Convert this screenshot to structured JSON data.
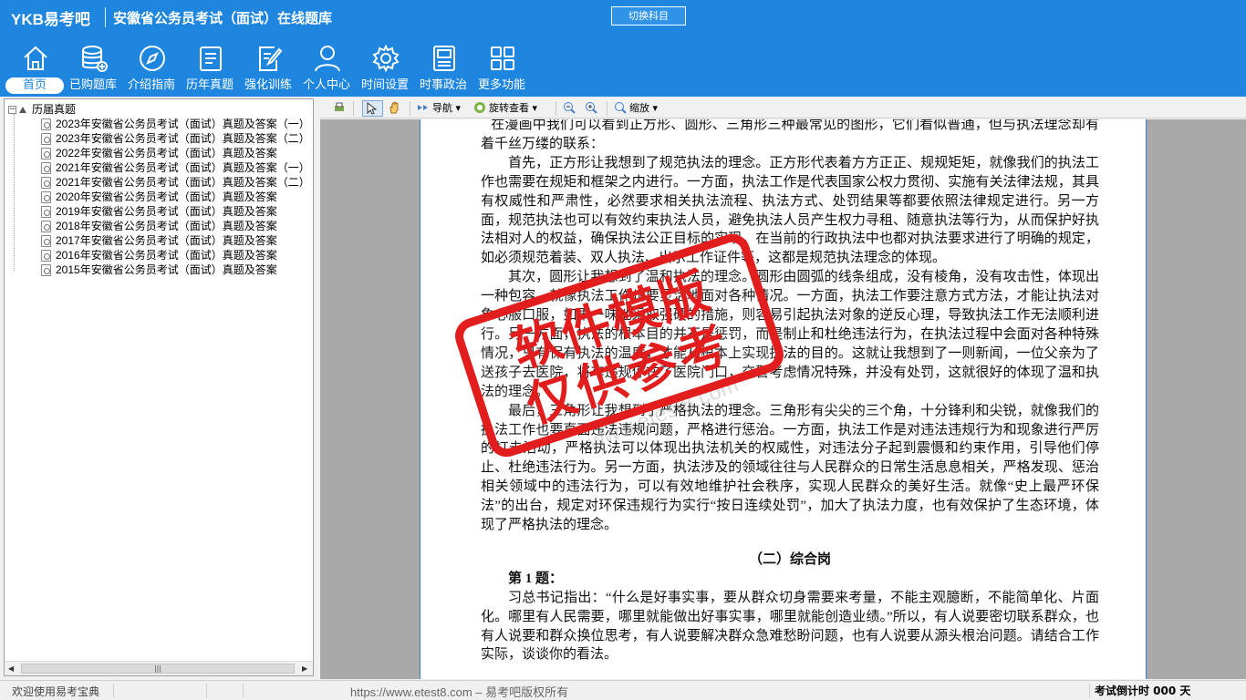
{
  "header": {
    "logo": "YKB易考吧",
    "app_title": "安徽省公务员考试（面试）在线题库",
    "switch_subject": "切换科目"
  },
  "nav": [
    {
      "label": "首页",
      "icon": "home-icon",
      "active": true
    },
    {
      "label": "已购题库",
      "icon": "database-icon"
    },
    {
      "label": "介绍指南",
      "icon": "compass-icon"
    },
    {
      "label": "历年真题",
      "icon": "list-icon"
    },
    {
      "label": "强化训练",
      "icon": "edit-icon"
    },
    {
      "label": "个人中心",
      "icon": "user-icon"
    },
    {
      "label": "时间设置",
      "icon": "gear-icon"
    },
    {
      "label": "时事政治",
      "icon": "news-icon"
    },
    {
      "label": "更多功能",
      "icon": "grid-icon"
    }
  ],
  "tree": {
    "root": "历届真题",
    "items": [
      "2023年安徽省公务员考试（面试）真题及答案（一）",
      "2023年安徽省公务员考试（面试）真题及答案（二）",
      "2022年安徽省公务员考试（面试）真题及答案",
      "2021年安徽省公务员考试（面试）真题及答案（一）",
      "2021年安徽省公务员考试（面试）真题及答案（二）",
      "2020年安徽省公务员考试（面试）真题及答案",
      "2019年安徽省公务员考试（面试）真题及答案",
      "2018年安徽省公务员考试（面试）真题及答案",
      "2017年安徽省公务员考试（面试）真题及答案",
      "2016年安徽省公务员考试（面试）真题及答案",
      "2015年安徽省公务员考试（面试）真题及答案"
    ]
  },
  "toolbar": {
    "navigate": "导航",
    "rotate_view": "旋转查看",
    "zoom": "缩放"
  },
  "document": {
    "p0": "在漫画中我们可以看到正方形、圆形、三角形三种最常见的图形，它们看似普通，但与执法理念却有着千丝万缕的联系：",
    "p1": "首先，正方形让我想到了规范执法的理念。正方形代表着方方正正、规规矩矩，就像我们的执法工作也需要在规矩和框架之内进行。一方面，执法工作是代表国家公权力贯彻、实施有关法律法规，其具有权威性和严肃性，必然要求相关执法流程、执法方式、处罚结果等都要依照法律规定进行。另一方面，规范执法也可以有效约束执法人员，避免执法人员产生权力寻租、随意执法等行为，从而保护好执法相对人的权益，确保执法公正目标的实现。在当前的行政执法中也都对执法要求进行了明确的规定，如必须规范着装、双人执法、出示工作证件等，这都是规范执法理念的体现。",
    "p2": "其次，圆形让我想到了温和执法的理念。圆形由圆弧的线条组成，没有棱角，没有攻击性，体现出一种包容，就像执法工作也要灵活地面对各种情况。一方面，执法工作要注意方式方法，才能让执法对象心服口服，如果一味地采取强硬的措施，则容易引起执法对象的逆反心理，导致执法工作无法顺利进行。另一方面，执法的根本目的并不是惩罚，而是制止和杜绝违法行为，在执法过程中会面对各种特殊情况，只有保有执法的温度，才能从根本上实现执法的目的。这就让我想到了一则新闻，一位父亲为了送孩子去医院，将车违规停在了医院门口，交警考虑情况特殊，并没有处罚，这就很好的体现了温和执法的理念。",
    "p3": "最后，三角形让我想到了严格执法的理念。三角形有尖尖的三个角，十分锋利和尖锐，就像我们的执法工作也要直面违法违规问题，严格进行惩治。一方面，执法工作是对违法违规行为和现象进行严厉的打击活动，严格执法可以体现出执法机关的权威性，对违法分子起到震慑和约束作用，引导他们停止、杜绝违法行为。另一方面，执法涉及的领域往往与人民群众的日常生活息息相关，严格发现、惩治相关领域中的违法行为，可以有效地维护社会秩序，实现人民群众的美好生活。就像“史上最严环保法”的出台，规定对环保违规行为实行“按日连续处罚”，加大了执法力度，也有效保护了生态环境，体现了严格执法的理念。",
    "section": "（二）综合岗",
    "q_title": "第 1 题：",
    "q_body": "习总书记指出：“什么是好事实事，要从群众切身需要来考量，不能主观臆断，不能简单化、片面化。哪里有人民需要，哪里就能做出好事实事，哪里就能创造业绩。”所以，有人说要密切联系群众，也有人说要和群众换位思考，有人说要解决群众急难愁盼问题，也有人说要从源头根治问题。请结合工作实际，谈谈你的看法。"
  },
  "stamp": {
    "line1": "软件模版",
    "line2": "仅供参考"
  },
  "watermark": "www.etest8.com",
  "status": {
    "welcome": "欢迎使用易考宝典",
    "copyright": "https://www.etest8.com – 易考吧版权所有",
    "countdown": "考试倒计时 000 天"
  }
}
